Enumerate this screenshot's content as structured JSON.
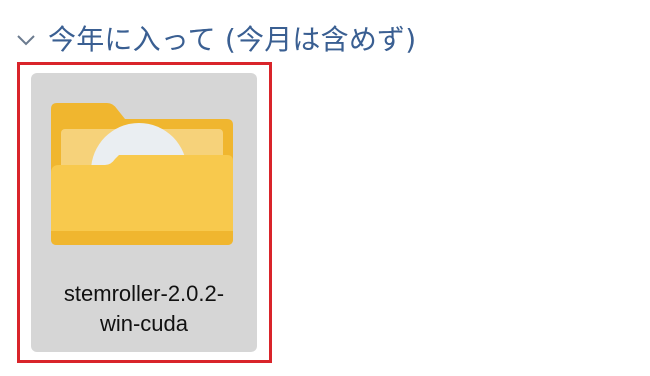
{
  "group": {
    "title": "今年に入って (今月は含めず)",
    "icon": "chevron-down-icon"
  },
  "item": {
    "name_line1": "stemroller-2.0.2-",
    "name_line2": "win-cuda",
    "icon": "folder-icon",
    "overlay_icon": "app-logo-icon",
    "highlight_color": "#d9242a",
    "tile_color": "#d6d6d6"
  }
}
